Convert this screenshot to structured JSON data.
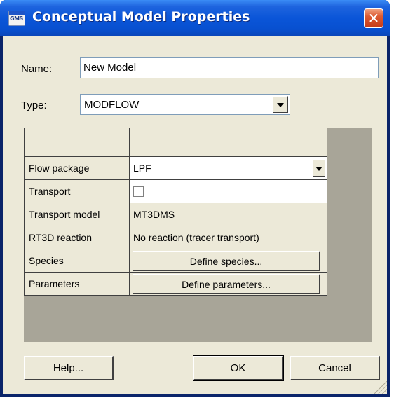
{
  "window": {
    "title": "Conceptual Model Properties",
    "icon_text": "GMS"
  },
  "form": {
    "name_label": "Name:",
    "name_value": "New Model",
    "type_label": "Type:",
    "type_value": "MODFLOW"
  },
  "grid": {
    "rows": [
      {
        "name": "Flow package",
        "value": "LPF"
      },
      {
        "name": "Transport",
        "value": ""
      },
      {
        "name": "Transport model",
        "value": "MT3DMS"
      },
      {
        "name": "RT3D reaction",
        "value": "No reaction (tracer transport)"
      },
      {
        "name": "Species",
        "value": "Define species..."
      },
      {
        "name": "Parameters",
        "value": "Define parameters..."
      }
    ],
    "transport_checked": false
  },
  "buttons": {
    "help": "Help...",
    "ok": "OK",
    "cancel": "Cancel"
  },
  "icons": {
    "close": "close-icon",
    "app": "gms-app-icon",
    "dropdown": "chevron-down-icon"
  }
}
